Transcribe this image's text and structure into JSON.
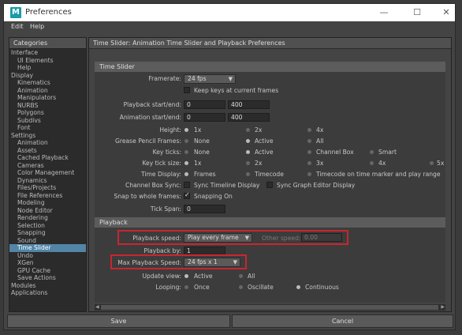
{
  "window": {
    "title": "Preferences",
    "logo_letter": "M"
  },
  "window_controls": {
    "minimize": "—",
    "maximize": "☐",
    "close": "✕"
  },
  "menubar": {
    "items": [
      "Edit",
      "Help"
    ]
  },
  "categories": {
    "header": "Categories",
    "items": [
      {
        "label": "Interface",
        "sub": false
      },
      {
        "label": "UI Elements",
        "sub": true
      },
      {
        "label": "Help",
        "sub": true
      },
      {
        "label": "Display",
        "sub": false
      },
      {
        "label": "Kinematics",
        "sub": true
      },
      {
        "label": "Animation",
        "sub": true
      },
      {
        "label": "Manipulators",
        "sub": true
      },
      {
        "label": "NURBS",
        "sub": true
      },
      {
        "label": "Polygons",
        "sub": true
      },
      {
        "label": "Subdivs",
        "sub": true
      },
      {
        "label": "Font",
        "sub": true
      },
      {
        "label": "Settings",
        "sub": false
      },
      {
        "label": "Animation",
        "sub": true
      },
      {
        "label": "Assets",
        "sub": true
      },
      {
        "label": "Cached Playback",
        "sub": true
      },
      {
        "label": "Cameras",
        "sub": true
      },
      {
        "label": "Color Management",
        "sub": true
      },
      {
        "label": "Dynamics",
        "sub": true
      },
      {
        "label": "Files/Projects",
        "sub": true
      },
      {
        "label": "File References",
        "sub": true
      },
      {
        "label": "Modeling",
        "sub": true
      },
      {
        "label": "Node Editor",
        "sub": true
      },
      {
        "label": "Rendering",
        "sub": true
      },
      {
        "label": "Selection",
        "sub": true
      },
      {
        "label": "Snapping",
        "sub": true
      },
      {
        "label": "Sound",
        "sub": true
      },
      {
        "label": "Time Slider",
        "sub": true,
        "selected": true
      },
      {
        "label": "Undo",
        "sub": true
      },
      {
        "label": "XGen",
        "sub": true
      },
      {
        "label": "GPU Cache",
        "sub": true
      },
      {
        "label": "Save Actions",
        "sub": true
      },
      {
        "label": "Modules",
        "sub": false
      },
      {
        "label": "Applications",
        "sub": false
      }
    ]
  },
  "panel": {
    "header": "Time Slider: Animation Time Slider and Playback Preferences",
    "time_slider": {
      "title": "Time Slider",
      "framerate_label": "Framerate:",
      "framerate_value": "24 fps",
      "keep_keys_label": "Keep keys at current frames",
      "playback_label": "Playback start/end:",
      "playback_start": "0",
      "playback_end": "400",
      "animation_label": "Animation start/end:",
      "animation_start": "0",
      "animation_end": "400",
      "height_label": "Height:",
      "height_options": [
        "1x",
        "2x",
        "4x"
      ],
      "grease_label": "Grease Pencil Frames:",
      "grease_options": [
        "None",
        "Active",
        "All"
      ],
      "keyticks_label": "Key ticks:",
      "keyticks_options": [
        "None",
        "Active",
        "Channel Box",
        "Smart"
      ],
      "ticksize_label": "Key tick size:",
      "ticksize_options": [
        "1x",
        "2x",
        "3x",
        "4x",
        "5x"
      ],
      "timedisplay_label": "Time Display:",
      "timedisplay_options": [
        "Frames",
        "Timecode",
        "Timecode on time marker and play range"
      ],
      "channelbox_label": "Channel Box Sync:",
      "channelbox_opt1": "Sync Timeline Display",
      "channelbox_opt2": "Sync Graph Editor Display",
      "snap_label": "Snap to whole frames:",
      "snap_value": "Snapping On",
      "tickspan_label": "Tick Span:",
      "tickspan_value": "0"
    },
    "playback": {
      "title": "Playback",
      "speed_label": "Playback speed:",
      "speed_value": "Play every frame",
      "other_label": "Other speed:",
      "other_value": "0.00",
      "by_label": "Playback by:",
      "by_value": "1",
      "max_label": "Max Playback Speed:",
      "max_value": "24 fps x 1",
      "update_label": "Update view:",
      "update_options": [
        "Active",
        "All"
      ],
      "looping_label": "Looping:",
      "looping_options": [
        "Once",
        "Oscillate",
        "Continuous"
      ]
    }
  },
  "buttons": {
    "save": "Save",
    "cancel": "Cancel"
  },
  "colors": {
    "highlight": "#c8262f",
    "selection": "#5285a6",
    "logo": "#1b9aa8"
  }
}
